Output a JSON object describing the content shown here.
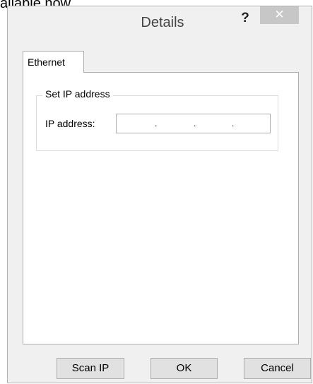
{
  "background": {
    "text": "ailable now."
  },
  "window": {
    "title": "Details",
    "help_label": "?",
    "close_label": "✕"
  },
  "tabs": [
    {
      "label": "Ethernet",
      "selected": true
    }
  ],
  "group": {
    "title": "Set IP address",
    "ip_label": "IP address:",
    "ip_value": "",
    "ip_separators": [
      ".",
      ".",
      "."
    ]
  },
  "buttons": {
    "scan_ip": "Scan IP",
    "ok": "OK",
    "cancel": "Cancel"
  },
  "colors": {
    "dialog_bg": "#f0f0f0",
    "close_button_bg": "#c7c7c7",
    "panel_bg": "#ffffff",
    "border": "#adadad"
  }
}
